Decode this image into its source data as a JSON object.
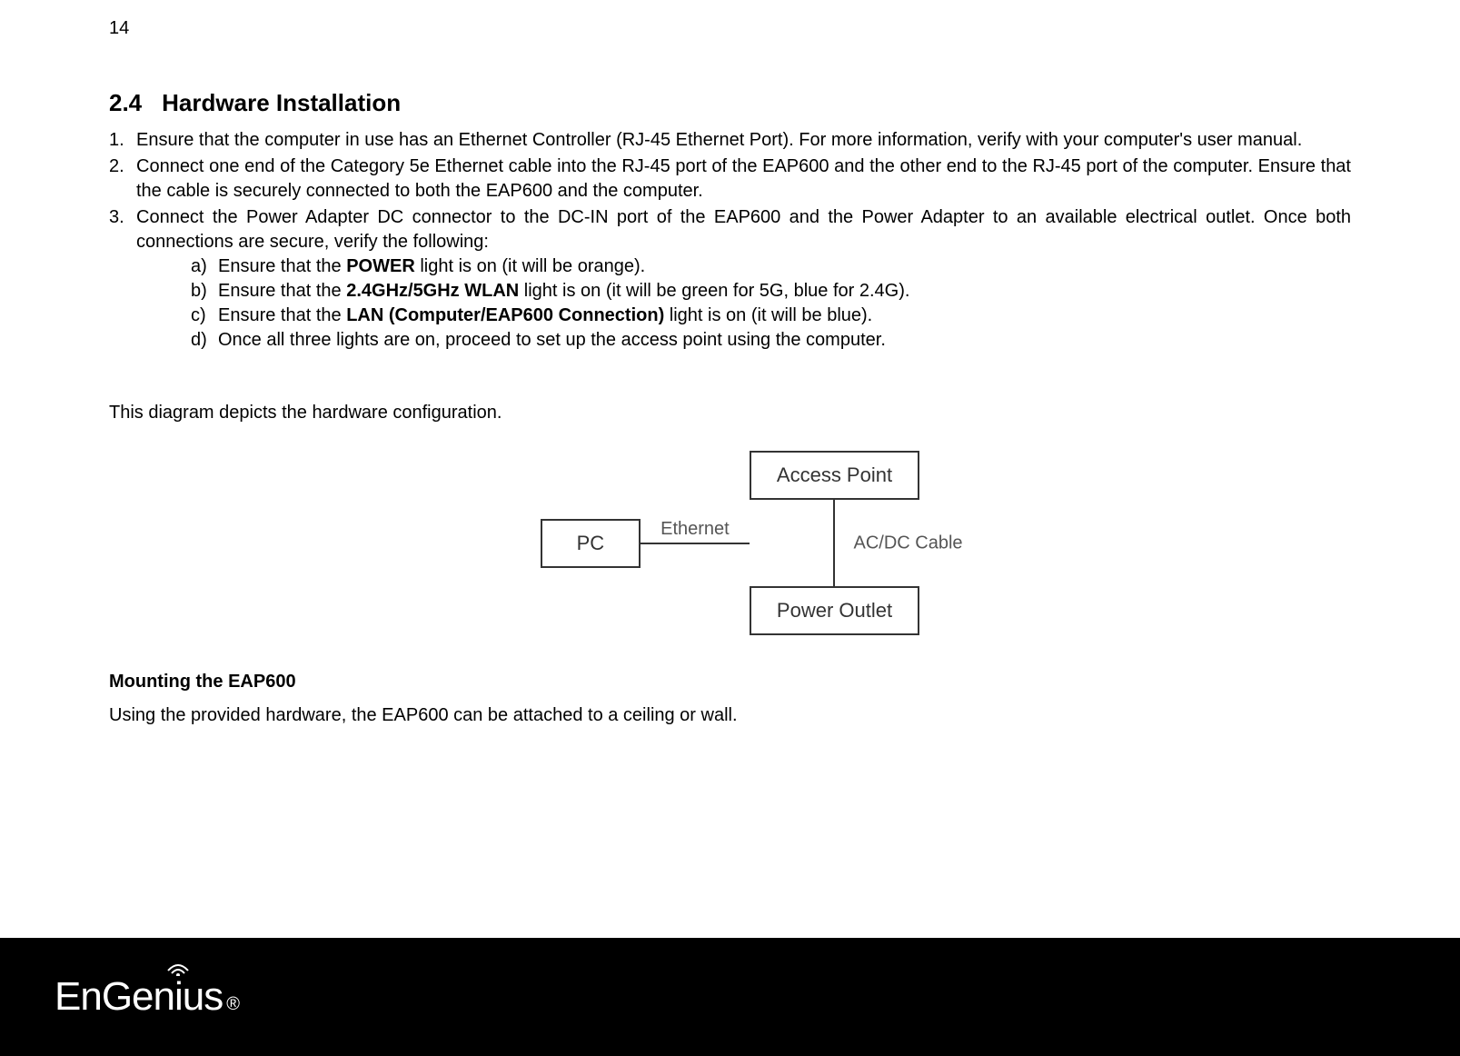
{
  "page_number": "14",
  "section": {
    "number": "2.4",
    "title": "Hardware Installation"
  },
  "steps": [
    {
      "text": "Ensure that the computer in use has an Ethernet Controller (RJ-45 Ethernet Port). For more information, verify with your computer's user manual."
    },
    {
      "text": "Connect one end of the Category 5e Ethernet cable into the RJ-45 port of the EAP600 and the other end to the RJ-45 port of the computer. Ensure that the cable is securely connected to both the EAP600 and the computer."
    },
    {
      "text": "Connect the Power Adapter DC connector to the DC-IN port of the EAP600 and the Power Adapter to an available electrical outlet. Once both connections are secure, verify the following:",
      "substeps": [
        {
          "pre": "Ensure that the ",
          "bold": "POWER",
          "post": " light is on (it will be orange)."
        },
        {
          "pre": "Ensure that the ",
          "bold": "2.4GHz/5GHz WLAN",
          "post": " light is on (it will be green for 5G, blue for 2.4G)."
        },
        {
          "pre": "Ensure that the ",
          "bold": "LAN (Computer/EAP600 Connection)",
          "post": " light is on (it will be blue)."
        },
        {
          "pre": "Once all three lights are on, proceed to set up the access point using the computer.",
          "bold": "",
          "post": ""
        }
      ]
    }
  ],
  "diagram": {
    "caption": "This diagram depicts the hardware configuration.",
    "boxes": {
      "pc": "PC",
      "access_point": "Access Point",
      "power_outlet": "Power Outlet"
    },
    "labels": {
      "ethernet": "Ethernet",
      "acdc": "AC/DC Cable"
    }
  },
  "mounting": {
    "heading": "Mounting the EAP600",
    "text": "Using the provided hardware, the EAP600 can be attached to a ceiling or wall."
  },
  "footer": {
    "logo_text": "EnGenius"
  }
}
